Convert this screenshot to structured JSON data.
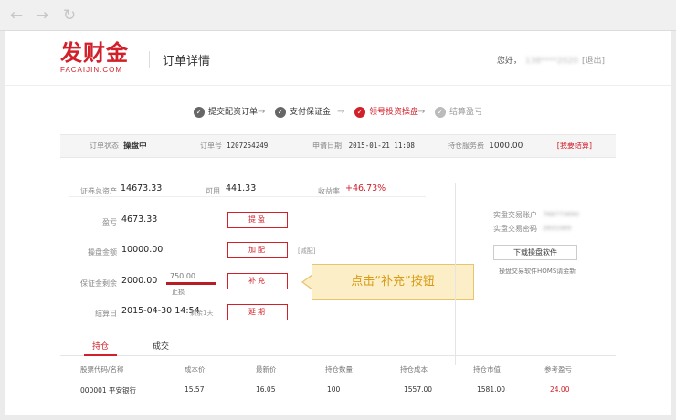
{
  "browser": {
    "back_icon": "back-arrow-icon",
    "forward_icon": "forward-arrow-icon",
    "reload_icon": "reload-icon"
  },
  "header": {
    "logo_text": "发财金",
    "logo_sub": "FACAIJIN.COM",
    "page_title": "订单详情",
    "greeting": "您好，",
    "user_phone": "138****2020",
    "logout": "[退出]"
  },
  "steps": [
    {
      "label": "提交配资订单",
      "state": "done"
    },
    {
      "label": "支付保证金",
      "state": "done"
    },
    {
      "label": "领号投资操盘",
      "state": "active"
    },
    {
      "label": "结算盈亏",
      "state": "inactive"
    }
  ],
  "order": {
    "status_label": "订单状态",
    "status_value": "操盘中",
    "number_label": "订单号",
    "number_value": "1207254249",
    "date_label": "申请日期",
    "date_value": "2015-01-21 11:08",
    "fee_label": "持仓服务费",
    "fee_value": "1000.00",
    "settle_link": "[我要结算]"
  },
  "account": {
    "total_assets_label": "证券总资产",
    "total_assets_value": "14673.33",
    "available_label": "可用",
    "available_value": "441.33",
    "yield_label": "收益率",
    "yield_value": "+46.73%",
    "profit_label": "盈亏",
    "profit_value": "4673.33",
    "trading_amount_label": "操盘金额",
    "trading_amount_value": "10000.00",
    "deposit_label": "保证金剩余",
    "deposit_value": "2000.00",
    "settle_date_label": "结算日",
    "settle_date_value": "2015-04-30 14:54",
    "days_left": "剩余1天",
    "stop_loss_value": "750.00",
    "stop_loss_label": "止损",
    "reduce_note": "[减配]"
  },
  "buttons": {
    "withdraw": "提盈",
    "add": "加配",
    "supplement": "补充",
    "extend": "延期"
  },
  "trading_account": {
    "account_label": "实盘交易账户",
    "account_value": "768773690",
    "password_label": "实盘交易密码",
    "password_value": "2831069",
    "download_button": "下载操盘软件",
    "download_note": "操盘交易软件HOMS请金新"
  },
  "callout_text": "点击“补充”按钮",
  "tabs": [
    {
      "label": "持仓"
    },
    {
      "label": "成交"
    }
  ],
  "holdings": {
    "headers": [
      "股票代码/名称",
      "成本价",
      "最新价",
      "持仓数量",
      "持仓成本",
      "持仓市值",
      "参考盈亏"
    ],
    "rows": [
      [
        "000001 平安银行",
        "15.57",
        "16.05",
        "100",
        "1557.00",
        "1581.00",
        "24.00"
      ]
    ]
  },
  "colors": {
    "brand": "#d1202a",
    "callout_bg": "#fcefc7",
    "callout_text": "#d89a17"
  }
}
